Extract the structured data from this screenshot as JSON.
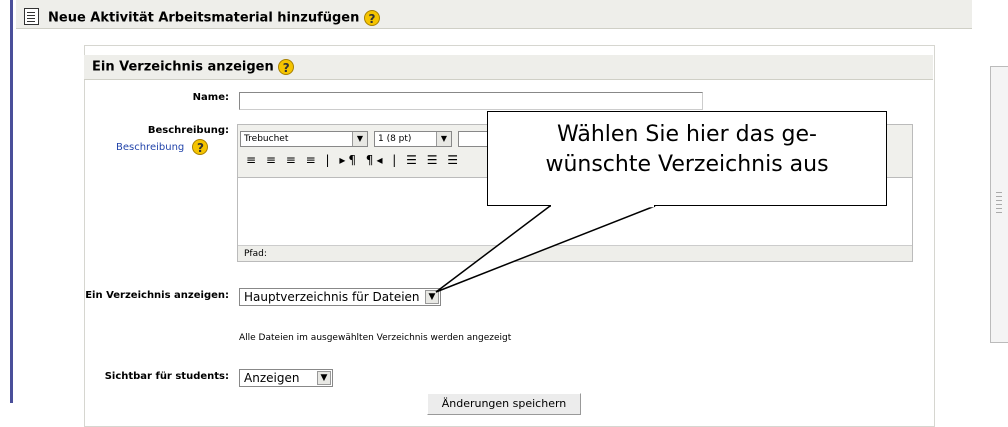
{
  "header": {
    "title": "Neue Aktivität Arbeitsmaterial hinzufügen",
    "help_glyph": "?"
  },
  "section": {
    "title": "Ein Verzeichnis anzeigen",
    "help_glyph": "?"
  },
  "form": {
    "name_label": "Name:",
    "name_value": "",
    "description_label": "Beschreibung:",
    "description_help_link": "Beschreibung",
    "editor": {
      "font_select": "Trebuchet",
      "size_select": "1 (8 pt)",
      "toolbar_glyphs": "≡ ≡ ≡ ≡ | ▸¶ ¶◂ | ☰ ☰ ☰",
      "path_label": "Pfad:"
    },
    "directory_label": "Ein Verzeichnis anzeigen:",
    "directory_value": "Hauptverzeichnis für Dateien",
    "directory_info": "Alle Dateien im ausgewählten Verzeichnis werden angezeigt",
    "visible_label": "Sichtbar für students:",
    "visible_value": "Anzeigen",
    "submit_label": "Änderungen speichern"
  },
  "callout": {
    "line1": "Wählen Sie hier das ge-",
    "line2": "wünschte Verzeichnis aus"
  },
  "icons": {
    "page": "page-icon",
    "help": "help-icon",
    "fullscreen": "fullscreen-icon",
    "dropdown": "chevron-down-icon"
  },
  "colors": {
    "accent": "#4a4f9a",
    "header_bg": "#eeeeea",
    "help_icon": "#f5c400",
    "link": "#2244aa"
  }
}
